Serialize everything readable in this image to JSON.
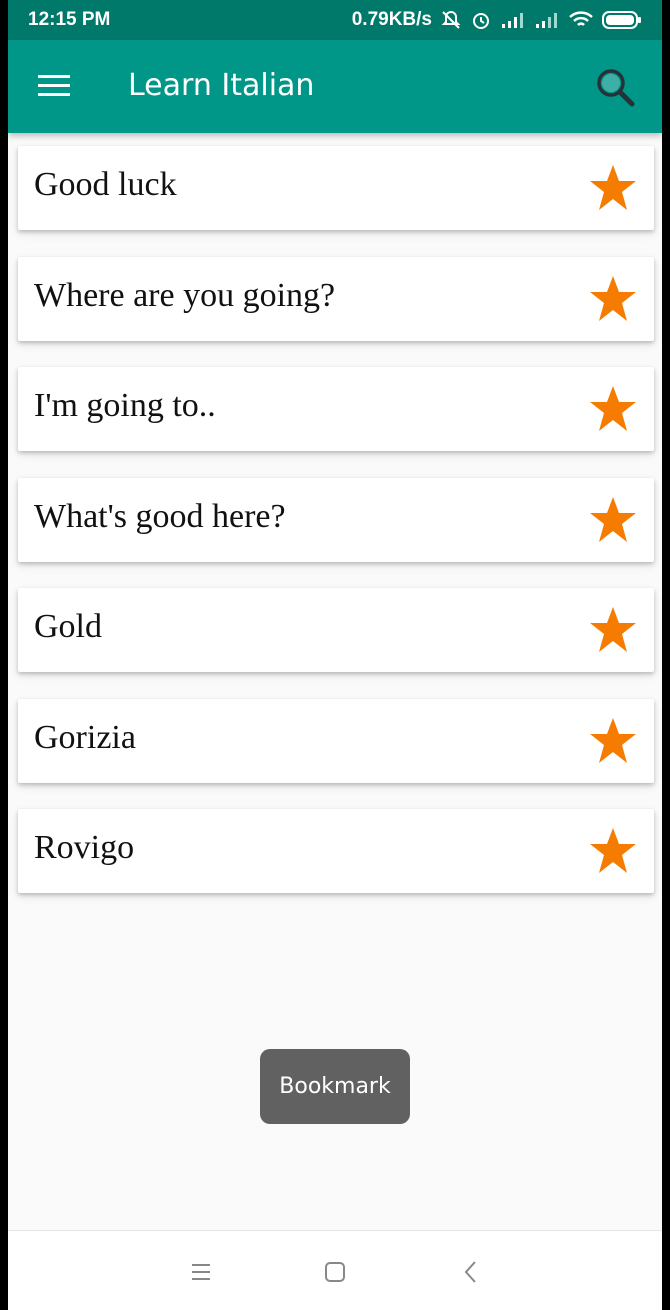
{
  "status_bar": {
    "time": "12:15 PM",
    "net_speed": "0.79KB/s",
    "icons": [
      "muted-alarm-icon",
      "alarm-clock-icon",
      "signal-icon",
      "signal-icon",
      "wifi-icon",
      "battery-icon"
    ]
  },
  "app_bar": {
    "title": "Learn Italian",
    "menu_icon": "hamburger-menu-icon",
    "search_icon": "search-icon",
    "color": "#009688"
  },
  "bookmarks": [
    {
      "text": "Good luck"
    },
    {
      "text": "Where are you going?"
    },
    {
      "text": "I'm going to.."
    },
    {
      "text": "What's good here?"
    },
    {
      "text": "Gold"
    },
    {
      "text": "Gorizia"
    },
    {
      "text": "Rovigo"
    }
  ],
  "star_color": "#f57c00",
  "toast": {
    "text": "Bookmark"
  },
  "nav_bar": {
    "icons": [
      "recents-icon",
      "home-icon",
      "back-icon"
    ]
  }
}
